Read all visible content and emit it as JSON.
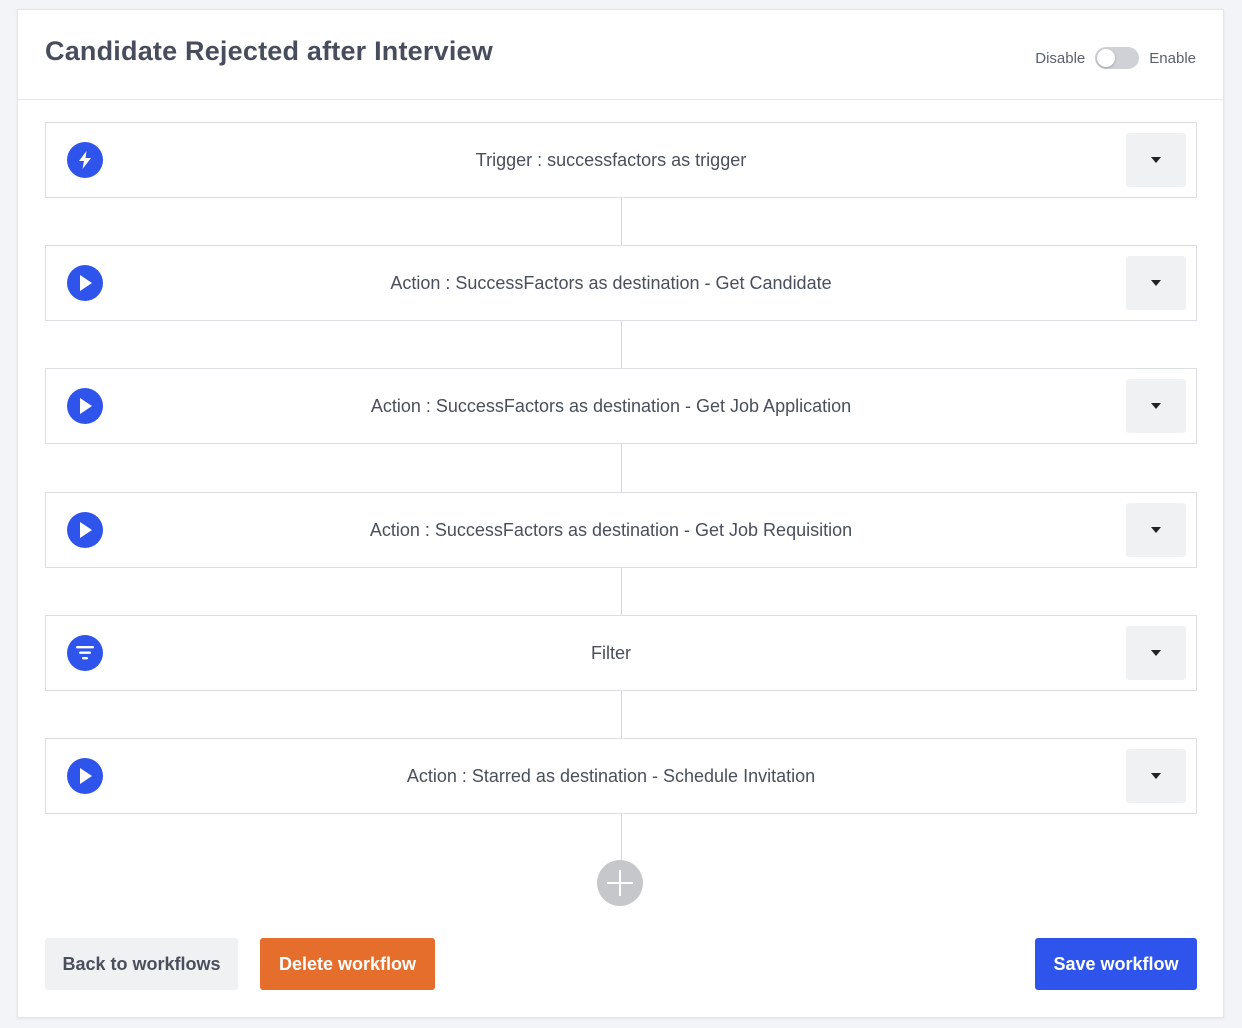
{
  "header": {
    "title": "Candidate Rejected after Interview",
    "toggle_off_label": "Disable",
    "toggle_on_label": "Enable",
    "enabled": false
  },
  "steps": [
    {
      "label": "Trigger : successfactors as trigger",
      "icon": "lightning-icon"
    },
    {
      "label": "Action : SuccessFactors as destination - Get Candidate",
      "icon": "play-icon"
    },
    {
      "label": "Action : SuccessFactors as destination - Get Job Application",
      "icon": "play-icon"
    },
    {
      "label": "Action : SuccessFactors as destination - Get Job Requisition",
      "icon": "play-icon"
    },
    {
      "label": "Filter",
      "icon": "filter-icon"
    },
    {
      "label": "Action : Starred as destination - Schedule Invitation",
      "icon": "play-icon"
    }
  ],
  "footer": {
    "back_label": "Back to workflows",
    "delete_label": "Delete workflow",
    "save_label": "Save workflow"
  },
  "colors": {
    "primary": "#2f54eb",
    "danger": "#e56e2d",
    "neutral": "#f0f1f3"
  }
}
